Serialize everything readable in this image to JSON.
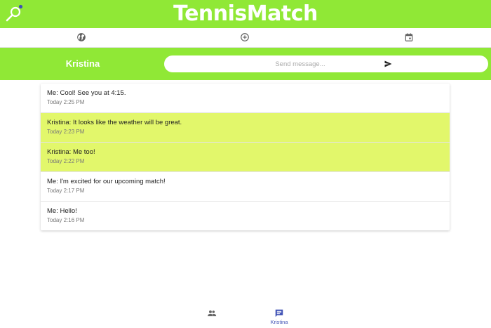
{
  "app": {
    "name": "TennisMatch"
  },
  "top_nav": {
    "icons": [
      "globe-icon",
      "add-circle-icon",
      "calendar-icon"
    ]
  },
  "chat": {
    "contact_name": "Kristina",
    "message_placeholder": "Send message...",
    "message_value": ""
  },
  "messages": [
    {
      "text": "Me: Cool! See you at 4:15.",
      "time": "Today 2:25 PM",
      "from": "me"
    },
    {
      "text": "Kristina: It looks like the weather will be great.",
      "time": "Today 2:23 PM",
      "from": "contact"
    },
    {
      "text": "Kristina: Me too!",
      "time": "Today 2:22 PM",
      "from": "contact"
    },
    {
      "text": "Me: I'm excited for our upcoming match!",
      "time": "Today 2:17 PM",
      "from": "me"
    },
    {
      "text": "Me: Hello!",
      "time": "Today 2:16 PM",
      "from": "me"
    }
  ],
  "bottom_nav": {
    "items": [
      {
        "icon": "people-icon",
        "label": ""
      },
      {
        "icon": "chat-icon",
        "label": "Kristina"
      }
    ]
  },
  "colors": {
    "brand_green": "#90e836",
    "incoming_highlight": "#e2f76b",
    "active_nav": "#3f51b5"
  }
}
